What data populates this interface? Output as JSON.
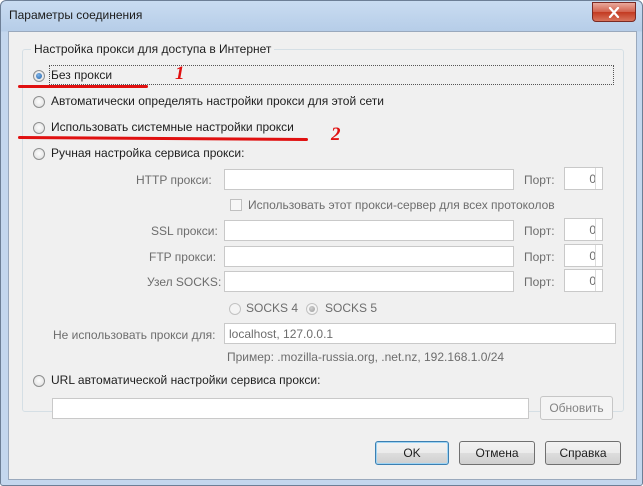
{
  "window": {
    "title": "Параметры соединения"
  },
  "group": {
    "title": "Настройка прокси для доступа в Интернет"
  },
  "options": {
    "no_proxy": "Без прокси",
    "auto_detect": "Автоматически определять настройки прокси для этой сети",
    "system": "Использовать системные настройки прокси",
    "manual": "Ручная настройка сервиса прокси:",
    "auto_url": "URL автоматической настройки сервиса прокси:"
  },
  "selected_option": "no_proxy",
  "manual": {
    "http_label": "HTTP прокси:",
    "ssl_label": "SSL прокси:",
    "ftp_label": "FTP прокси:",
    "socks_label": "Узел SOCKS:",
    "port_label": "Порт:",
    "http_port": "0",
    "ssl_port": "0",
    "ftp_port": "0",
    "socks_port": "0",
    "share_checkbox": "Использовать этот прокси-сервер для всех протоколов",
    "socks4": "SOCKS 4",
    "socks5": "SOCKS 5",
    "no_proxy_for_label": "Не использовать прокси для:",
    "no_proxy_for_value": "localhost, 127.0.0.1",
    "example": "Пример: .mozilla-russia.org, .net.nz, 192.168.1.0/24"
  },
  "auto_url": {
    "value": "",
    "reload_button": "Обновить"
  },
  "buttons": {
    "ok": "OK",
    "cancel": "Отмена",
    "help": "Справка"
  },
  "annotations": {
    "one": "1",
    "two": "2"
  },
  "colors": {
    "annotation": "#e01010",
    "title_bar": "#b6cde8",
    "dialog_bg": "#f0f0f0"
  }
}
